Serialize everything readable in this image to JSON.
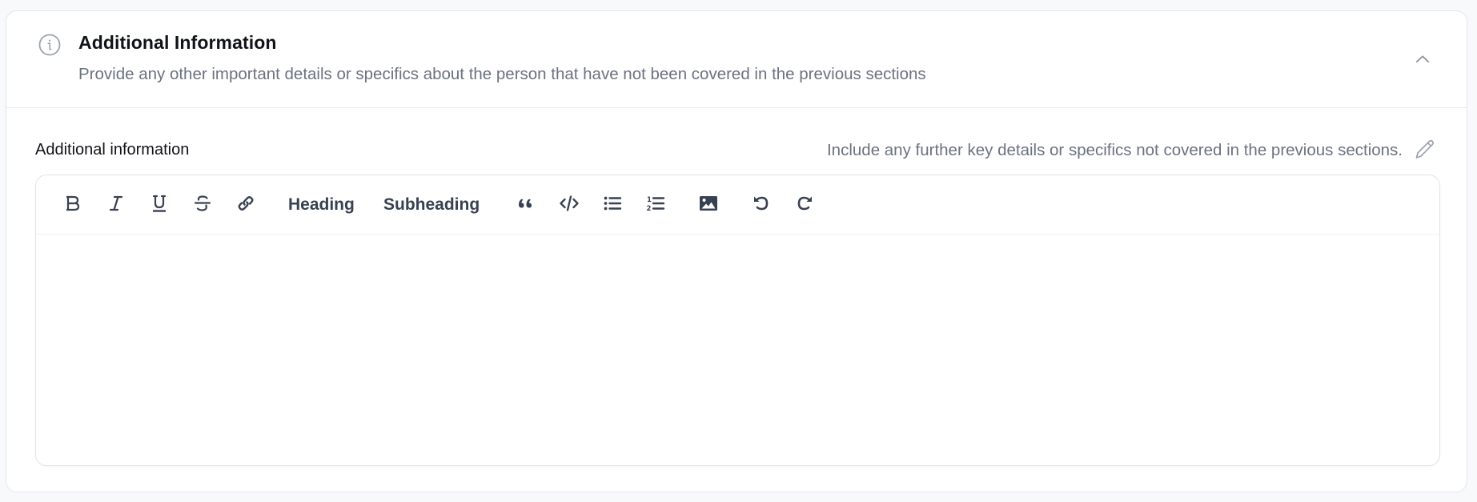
{
  "section": {
    "title": "Additional Information",
    "subtitle": "Provide any other important details or specifics about the person that have not been covered in the previous sections",
    "header_icon": "info-icon",
    "collapse_icon": "chevron-up-icon",
    "expanded": true
  },
  "field": {
    "label": "Additional information",
    "hint": "Include any further key details or specifics not covered in the previous sections.",
    "edit_icon": "pencil-icon",
    "value": ""
  },
  "toolbar": {
    "items": [
      {
        "id": "bold",
        "icon": "bold-icon",
        "label": "Bold"
      },
      {
        "id": "italic",
        "icon": "italic-icon",
        "label": "Italic"
      },
      {
        "id": "underline",
        "icon": "underline-icon",
        "label": "Underline"
      },
      {
        "id": "strikethrough",
        "icon": "strikethrough-icon",
        "label": "Strikethrough"
      },
      {
        "id": "link",
        "icon": "link-icon",
        "label": "Link"
      },
      {
        "id": "heading",
        "text": "Heading"
      },
      {
        "id": "subheading",
        "text": "Subheading"
      },
      {
        "id": "blockquote",
        "icon": "quote-icon",
        "label": "Blockquote"
      },
      {
        "id": "code",
        "icon": "code-icon",
        "label": "Code"
      },
      {
        "id": "bullet-list",
        "icon": "bullet-list-icon",
        "label": "Bullet list"
      },
      {
        "id": "ordered-list",
        "icon": "ordered-list-icon",
        "label": "Ordered list"
      },
      {
        "id": "image",
        "icon": "image-icon",
        "label": "Image"
      },
      {
        "id": "undo",
        "icon": "undo-icon",
        "label": "Undo"
      },
      {
        "id": "redo",
        "icon": "redo-icon",
        "label": "Redo"
      }
    ]
  },
  "colors": {
    "toolbar_icon": "#374151",
    "muted_text": "#6b7280",
    "heading_text": "#111318",
    "border": "#e4e6ea",
    "page_bg": "#f8f9fb"
  }
}
